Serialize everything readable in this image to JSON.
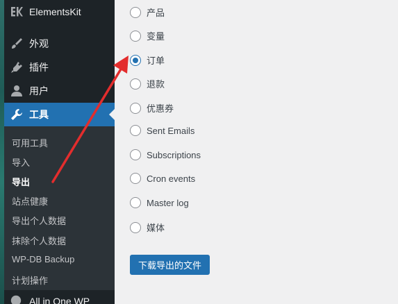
{
  "sidebar": {
    "plugin_title": "ElementsKit",
    "menu": [
      {
        "label": "外观",
        "icon": "paintbrush-icon"
      },
      {
        "label": "插件",
        "icon": "plugin-icon"
      },
      {
        "label": "用户",
        "icon": "user-icon"
      },
      {
        "label": "工具",
        "icon": "wrench-icon",
        "active": true
      }
    ],
    "submenu": [
      "可用工具",
      "导入",
      "导出",
      "站点健康",
      "导出个人数据",
      "抹除个人数据",
      "WP-DB Backup",
      "计划操作"
    ],
    "current_submenu": "导出",
    "bottom_item": "All in One WP"
  },
  "export": {
    "options": [
      "产品",
      "变量",
      "订单",
      "退款",
      "优惠券",
      "Sent Emails",
      "Subscriptions",
      "Cron events",
      "Master log",
      "媒体"
    ],
    "selected": "订单",
    "download_label": "下载导出的文件"
  },
  "colors": {
    "sidebar_bg": "#1d2327",
    "submenu_bg": "#2c3338",
    "accent": "#2271b1",
    "annotation_arrow": "#e32d2d"
  }
}
